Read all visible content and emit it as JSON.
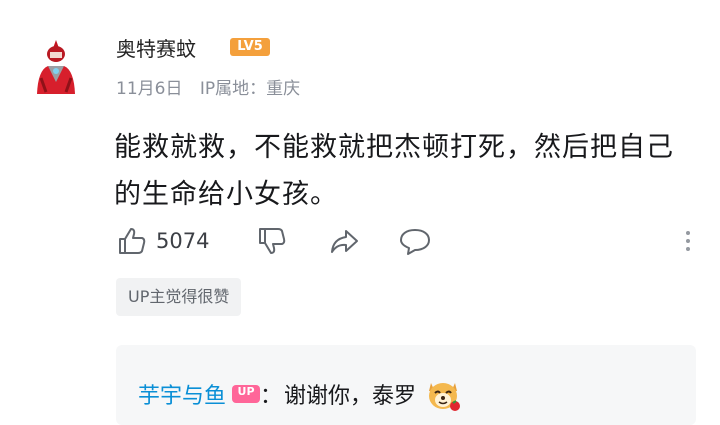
{
  "comment": {
    "username": "奥特赛蚊",
    "level_badge": "LV5",
    "date": "11月6日",
    "ip_location": "IP属地：重庆",
    "content": "能救就救，不能救就把杰顿打死，然后把自己的生命给小女孩。",
    "like_count": "5074",
    "up_tag": "UP主觉得很赞",
    "icons": [
      "avatar",
      "thumb-up-icon",
      "thumb-down-icon",
      "share-icon",
      "reply-icon",
      "more-icon"
    ]
  },
  "reply": {
    "username": "芋宇与鱼",
    "badge": "UP",
    "separator": "：",
    "text": "谢谢你，泰罗",
    "emoji": "dog-emoji"
  },
  "colors": {
    "level_badge": "#f4a03c",
    "up_badge": "#ff6699",
    "reply_name": "#0a8fd6",
    "meta_text": "#8a8f99"
  }
}
